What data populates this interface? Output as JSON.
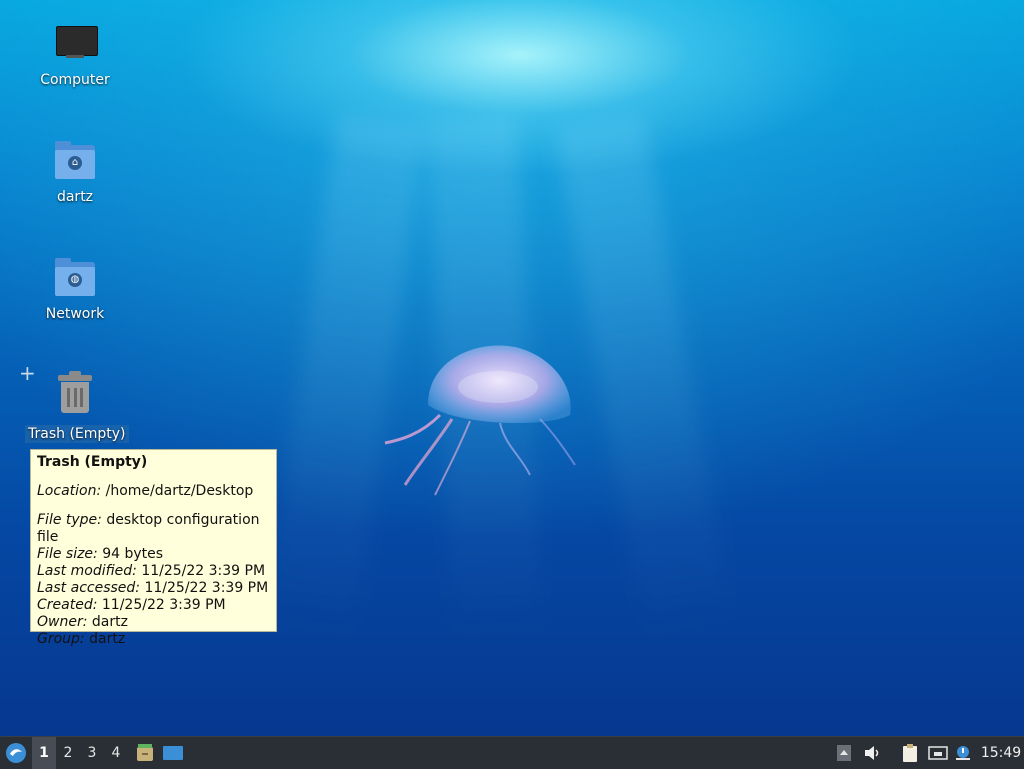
{
  "desktop": {
    "icons": [
      {
        "label": "Computer",
        "icon": "computer-icon"
      },
      {
        "label": "dartz",
        "icon": "home-folder-icon"
      },
      {
        "label": "Network",
        "icon": "network-folder-icon"
      },
      {
        "label": "Trash (Empty)",
        "icon": "trash-icon"
      }
    ]
  },
  "tooltip": {
    "title": "Trash (Empty)",
    "location_key": "Location:",
    "location_val": "/home/dartz/Desktop",
    "filetype_key": "File type:",
    "filetype_val": "desktop configuration file",
    "filesize_key": "File size:",
    "filesize_val": "94 bytes",
    "modified_key": "Last modified:",
    "modified_val": "11/25/22 3:39 PM",
    "accessed_key": "Last accessed:",
    "accessed_val": "11/25/22 3:39 PM",
    "created_key": "Created:",
    "created_val": "11/25/22 3:39 PM",
    "owner_key": "Owner:",
    "owner_val": "dartz",
    "group_key": "Group:",
    "group_val": "dartz"
  },
  "taskbar": {
    "workspaces": [
      "1",
      "2",
      "3",
      "4"
    ],
    "active_workspace": "1",
    "clock": "15:49",
    "colors": {
      "panel": "#2a2e35",
      "accent": "#3a8fd6"
    }
  }
}
